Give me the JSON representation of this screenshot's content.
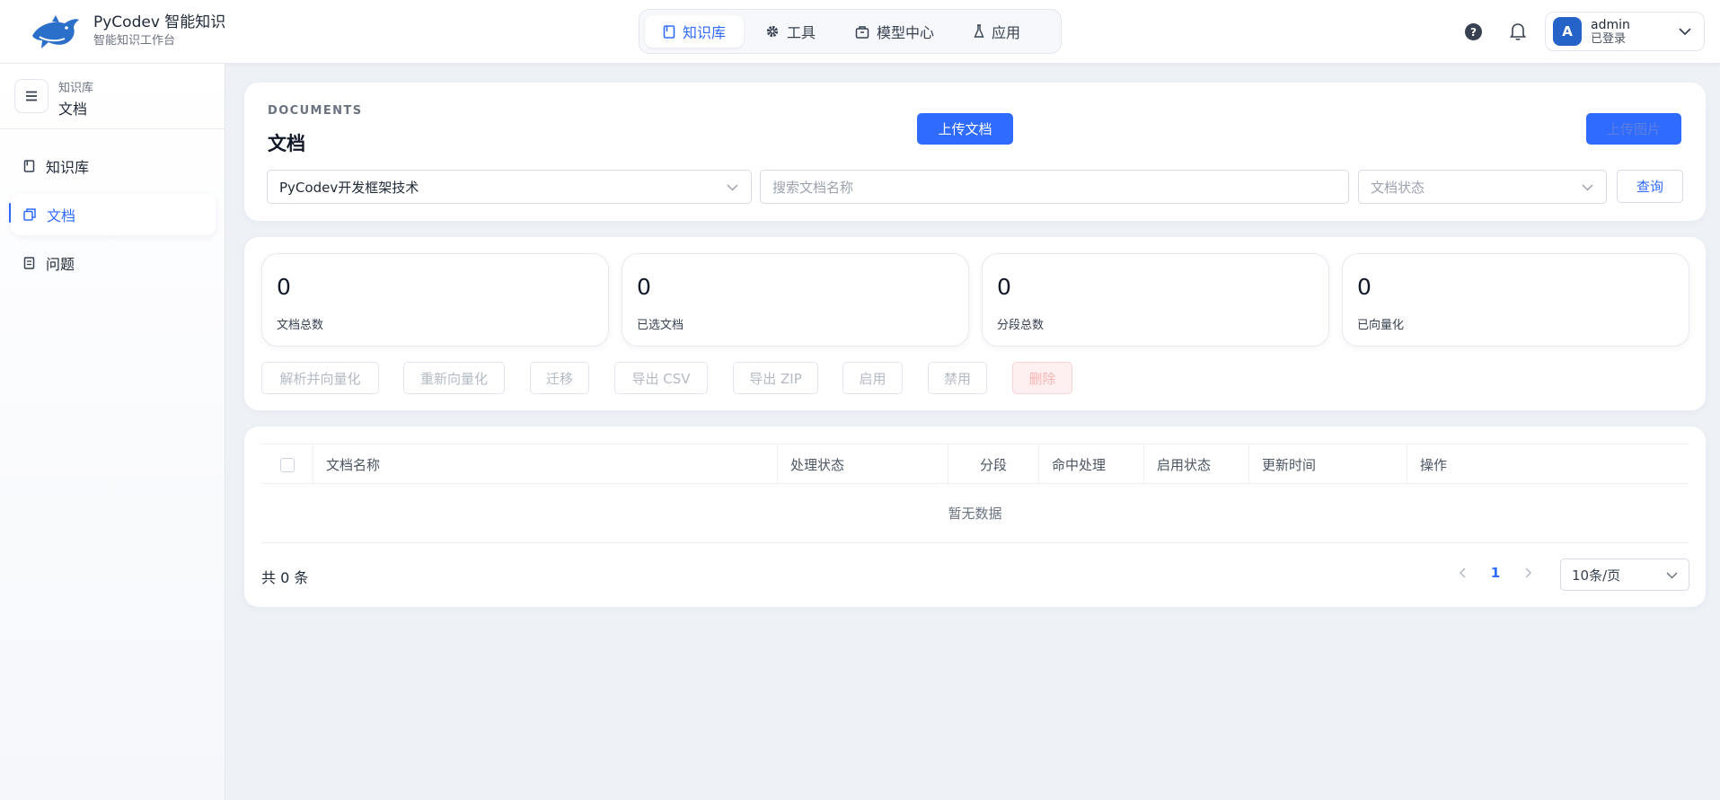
{
  "header": {
    "brand_title": "PyCodev 智能知识",
    "brand_subtitle": "智能知识工作台",
    "nav": [
      {
        "label": "知识库",
        "icon": "book-icon",
        "active": true
      },
      {
        "label": "工具",
        "icon": "gear-icon",
        "active": false
      },
      {
        "label": "模型中心",
        "icon": "box-icon",
        "active": false
      },
      {
        "label": "应用",
        "icon": "flask-icon",
        "active": false
      }
    ],
    "help_icon_glyph": "?",
    "user": {
      "avatar_letter": "A",
      "name": "admin",
      "status": "已登录"
    }
  },
  "sidebar": {
    "crumb": "知识库",
    "title": "文档",
    "items": [
      {
        "label": "知识库",
        "icon": "book-icon",
        "active": false
      },
      {
        "label": "文档",
        "icon": "copy-icon",
        "active": true
      },
      {
        "label": "问题",
        "icon": "list-icon",
        "active": false
      }
    ]
  },
  "documents": {
    "eyebrow": "DOCUMENTS",
    "title": "文档",
    "upload_doc_label": "上传文档",
    "upload_image_label": "上传图片",
    "kb_select_value": "PyCodev开发框架技术",
    "search_placeholder": "搜索文档名称",
    "status_placeholder": "文档状态",
    "query_label": "查询"
  },
  "stats": [
    {
      "value": "0",
      "label": "文档总数"
    },
    {
      "value": "0",
      "label": "已选文档"
    },
    {
      "value": "0",
      "label": "分段总数"
    },
    {
      "value": "0",
      "label": "已向量化"
    }
  ],
  "actions": [
    "解析并向量化",
    "重新向量化",
    "迁移",
    "导出 CSV",
    "导出 ZIP",
    "启用",
    "禁用",
    "删除"
  ],
  "table": {
    "columns": [
      "文档名称",
      "处理状态",
      "分段",
      "命中处理",
      "启用状态",
      "更新时间",
      "操作"
    ],
    "empty_text": "暂无数据",
    "total_text": "共 0 条",
    "current_page": "1",
    "page_size": "10条/页"
  },
  "colors": {
    "primary": "#2f6bff",
    "danger_bg": "#fef0f0",
    "avatar": "#2563c9"
  }
}
